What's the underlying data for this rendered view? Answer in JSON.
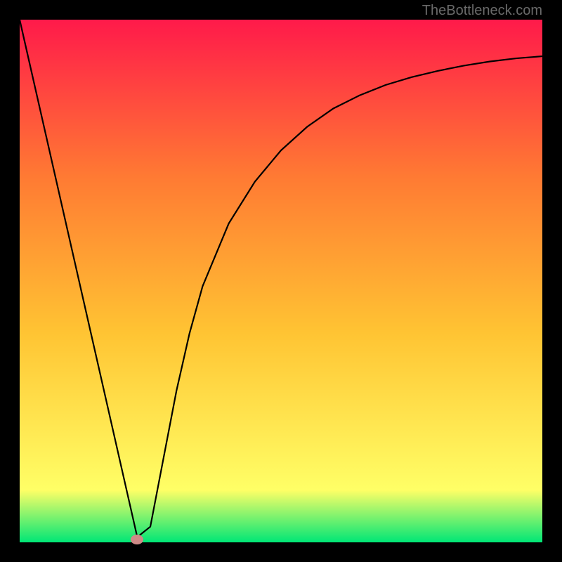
{
  "watermark": "TheBottleneck.com",
  "chart_data": {
    "type": "line",
    "title": "",
    "xlabel": "",
    "ylabel": "",
    "xlim": [
      0,
      100
    ],
    "ylim": [
      0,
      100
    ],
    "background_gradient": {
      "top": "#ff1a4a",
      "upper_mid": "#ff7a33",
      "mid": "#ffc433",
      "lower_mid": "#ffff66",
      "bottom": "#00e676"
    },
    "series": [
      {
        "name": "curve",
        "x": [
          0,
          5,
          10,
          15,
          20,
          22.5,
          25,
          27.5,
          30,
          32.5,
          35,
          40,
          45,
          50,
          55,
          60,
          65,
          70,
          75,
          80,
          85,
          90,
          95,
          100
        ],
        "y": [
          100,
          78,
          56,
          34,
          12,
          1,
          3,
          16,
          29,
          40,
          49,
          61,
          69,
          75,
          79.5,
          83,
          85.5,
          87.5,
          89,
          90.2,
          91.2,
          92,
          92.6,
          93
        ]
      }
    ],
    "marker": {
      "x": 22.5,
      "y": 0.5,
      "color": "#cf8a87"
    }
  }
}
